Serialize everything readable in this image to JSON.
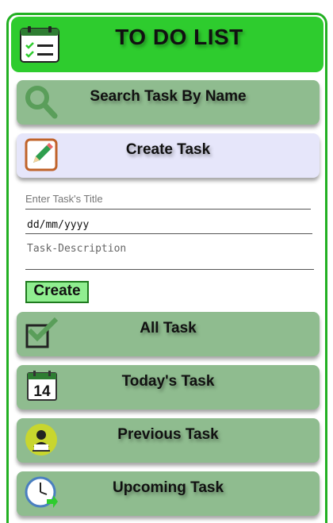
{
  "app": {
    "title": "TO DO LIST",
    "logo_icon": "calendar-checklist-icon"
  },
  "menu": {
    "search": {
      "label": "Search Task By Name",
      "icon": "search-icon"
    },
    "create": {
      "label": "Create Task",
      "icon": "pencil-icon"
    },
    "all": {
      "label": "All Task",
      "icon": "checkbox-icon"
    },
    "today": {
      "label": "Today's Task",
      "icon": "calendar-day-icon",
      "day": "14"
    },
    "previous": {
      "label": "Previous Task",
      "icon": "person-at-desk-icon"
    },
    "upcoming": {
      "label": "Upcoming Task",
      "icon": "clock-icon"
    }
  },
  "form": {
    "title_placeholder": "Enter Task's Title",
    "date_value": "dd/mm/yyyy",
    "description_placeholder": "Task-Description",
    "create_label": "Create"
  },
  "colors": {
    "header": "#2ecc2e",
    "card": "#8fbc8f",
    "card_active": "#e6e6fa",
    "button": "#90ee90",
    "border": "#22b022"
  }
}
